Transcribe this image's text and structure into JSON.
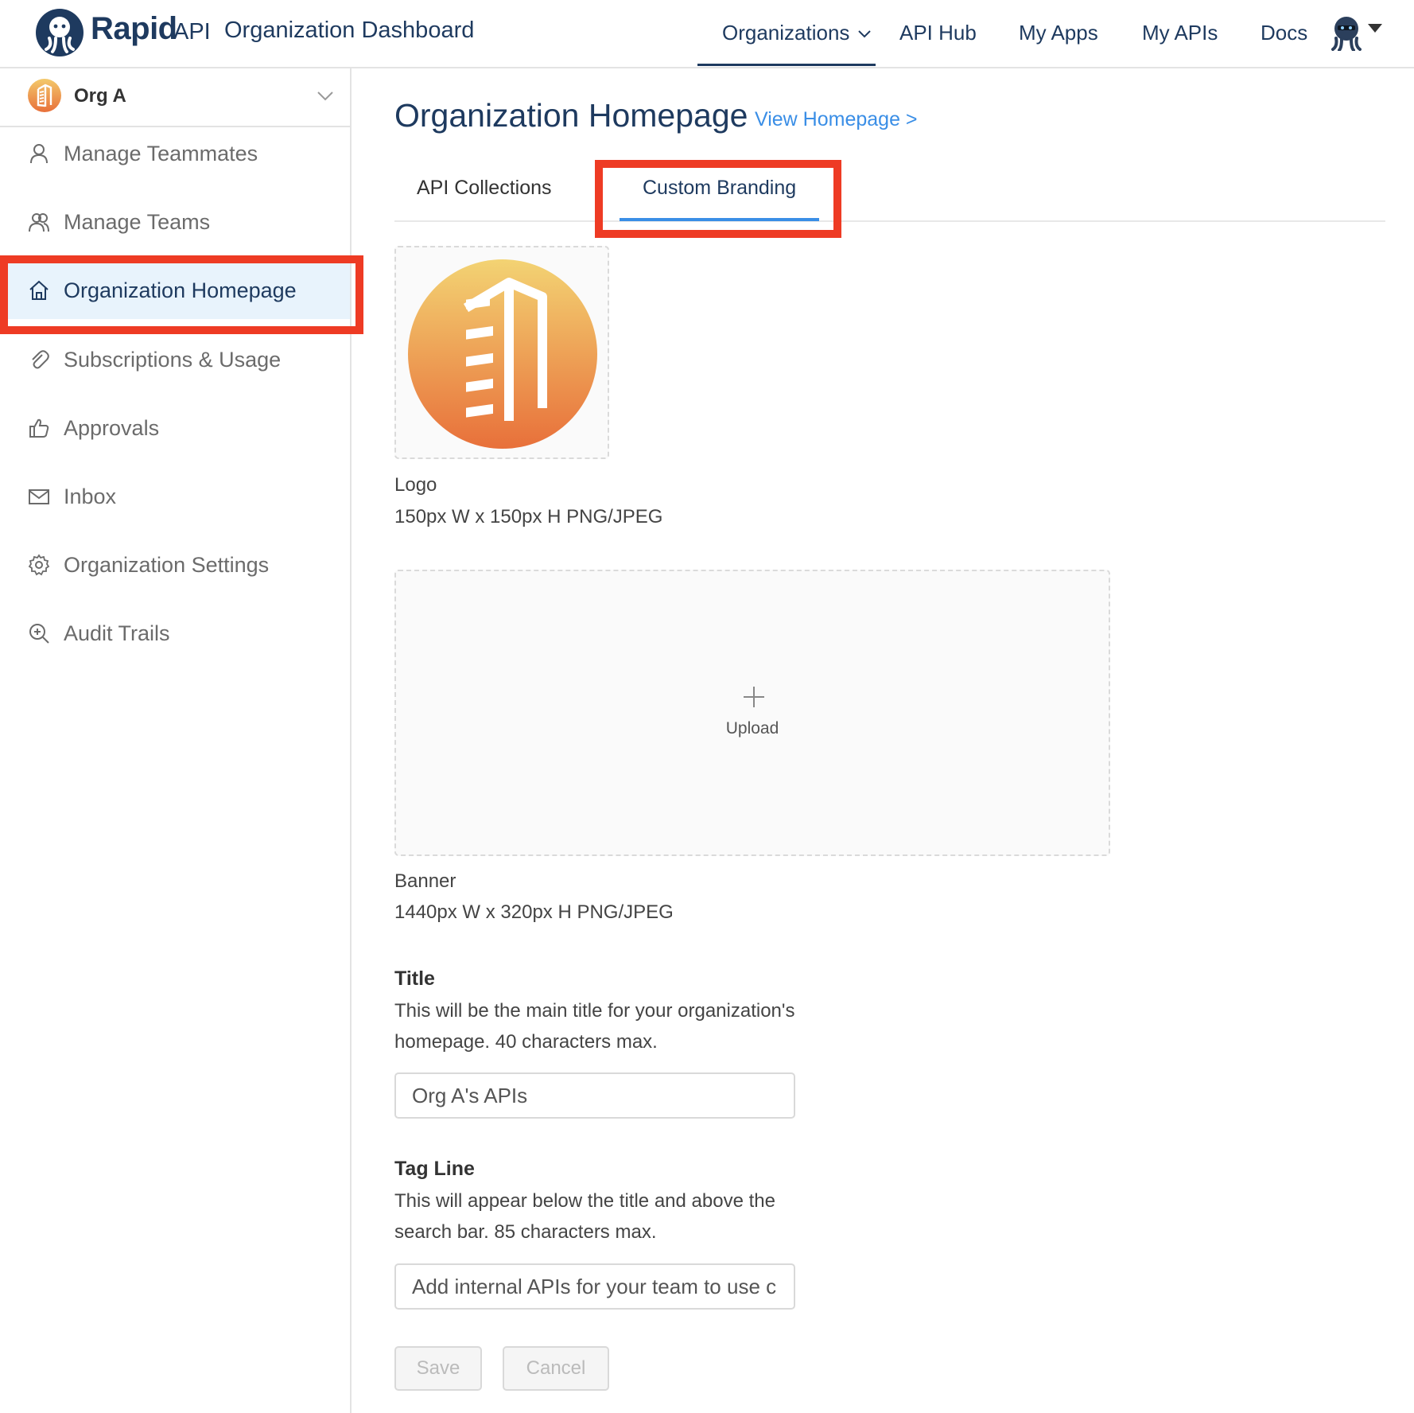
{
  "header": {
    "brand_rapid": "Rapid",
    "brand_api": "API",
    "app_title": "Organization Dashboard",
    "nav": [
      {
        "label": "Organizations"
      },
      {
        "label": "API Hub"
      },
      {
        "label": "My Apps"
      },
      {
        "label": "My APIs"
      },
      {
        "label": "Docs"
      }
    ],
    "active_nav": "Organizations"
  },
  "sidebar": {
    "org_name": "Org A",
    "items": [
      {
        "label": "Manage Teammates",
        "icon": "user-icon"
      },
      {
        "label": "Manage Teams",
        "icon": "team-icon"
      },
      {
        "label": "Organization Homepage",
        "icon": "home-icon",
        "active": true
      },
      {
        "label": "Subscriptions & Usage",
        "icon": "paperclip-icon"
      },
      {
        "label": "Approvals",
        "icon": "thumbs-up-icon"
      },
      {
        "label": "Inbox",
        "icon": "mail-icon"
      },
      {
        "label": "Organization Settings",
        "icon": "gear-icon"
      },
      {
        "label": "Audit Trails",
        "icon": "zoom-plus-icon"
      }
    ]
  },
  "main": {
    "page_title": "Organization Homepage",
    "view_homepage_link": "View Homepage >",
    "tabs": [
      {
        "label": "API Collections"
      },
      {
        "label": "Custom Branding",
        "active": true
      }
    ],
    "logo": {
      "label": "Logo",
      "spec": "150px W x 150px H PNG/JPEG"
    },
    "banner": {
      "upload_label": "Upload",
      "label": "Banner",
      "spec": "1440px W x 320px H PNG/JPEG"
    },
    "title_field": {
      "label": "Title",
      "help": "This will be the main title for your organization's homepage. 40 characters max.",
      "value": "Org A's APIs"
    },
    "tagline_field": {
      "label": "Tag Line",
      "help": "This will appear below the title and above the search bar. 85 characters max.",
      "value": "Add internal APIs for your team to use c"
    },
    "buttons": {
      "save": "Save",
      "cancel": "Cancel"
    }
  },
  "colors": {
    "brand_navy": "#1e3a5f",
    "link_blue": "#3a8ee6",
    "highlight_red": "#ee3b24",
    "active_bg": "#e8f3fc",
    "logo_gradient_top": "#f3c96b",
    "logo_gradient_bottom": "#e8703a"
  }
}
